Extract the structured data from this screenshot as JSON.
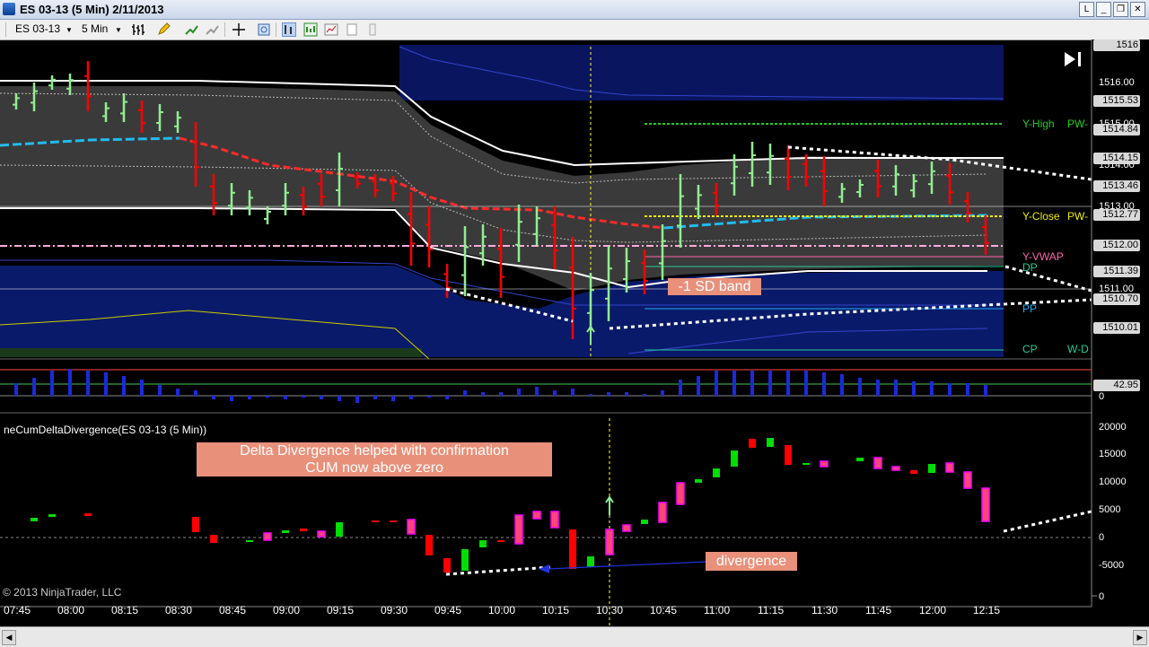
{
  "window": {
    "title": "ES 03-13 (5 Min)  2/11/2013",
    "btn_l": "L",
    "btn_min": "_",
    "btn_restore": "❐",
    "btn_close": "✕"
  },
  "toolbar": {
    "instrument": "ES 03-13",
    "interval": "5 Min",
    "icons": [
      "bar-type-icon",
      "draw-pencil-icon",
      "add-indicator-icon",
      "strategy-icon",
      "crosshair-icon",
      "zoom-icon",
      "chart-style-icon",
      "data-box-icon",
      "properties-icon",
      "print-icon",
      "filter-icon"
    ]
  },
  "price_axis": {
    "labels": [
      "1516.00",
      "1515.00",
      "1514.00",
      "1513.00",
      "1512.00",
      "1511.00"
    ],
    "tags": [
      "1516",
      "1515.53",
      "1514.84",
      "1514.15",
      "1513.46",
      "1512.77",
      "1512.00",
      "1511.39",
      "1510.70",
      "1510.01"
    ]
  },
  "levels": {
    "y_high": "Y-High",
    "pw_h": "PW-",
    "y_close": "Y-Close",
    "pw_c": "PW-",
    "y_vwap": "Y-VWAP",
    "dp": "DP",
    "pp": "PP",
    "cp": "CP",
    "w_d": "W-D"
  },
  "volume_axis": {
    "tag": "42.95",
    "zero": "0"
  },
  "indicator": {
    "name": "neCumDeltaDivergence(ES 03-13 (5 Min))",
    "axis": [
      "20000",
      "15000",
      "10000",
      "5000",
      "0",
      "-5000",
      "0"
    ]
  },
  "annotations": {
    "sd_band": "-1 SD band",
    "delta_line1": "Delta Divergence helped with confirmation",
    "delta_line2": "CUM now above zero",
    "divergence": "divergence"
  },
  "time_axis": [
    "07:45",
    "08:00",
    "08:15",
    "08:30",
    "08:45",
    "09:00",
    "09:15",
    "09:30",
    "09:45",
    "10:00",
    "10:15",
    "10:30",
    "10:45",
    "11:00",
    "11:15",
    "11:30",
    "11:45",
    "12:00",
    "12:15"
  ],
  "copyright": "© 2013 NinjaTrader, LLC",
  "colors": {
    "up_bar": "#90ee90",
    "down_bar": "#ff0000",
    "vwap": "#ff2a2a",
    "blue_dash": "#22bbee",
    "band_fill": "#3a3a3a",
    "lower_fill": "#0a1a6a",
    "y_high": "#22cc22",
    "y_close": "#eeee00",
    "y_vwap": "#ff66aa",
    "delta_up": "#00dd00",
    "delta_down": "#ff0000",
    "delta_magenta": "#ff00ff"
  }
}
